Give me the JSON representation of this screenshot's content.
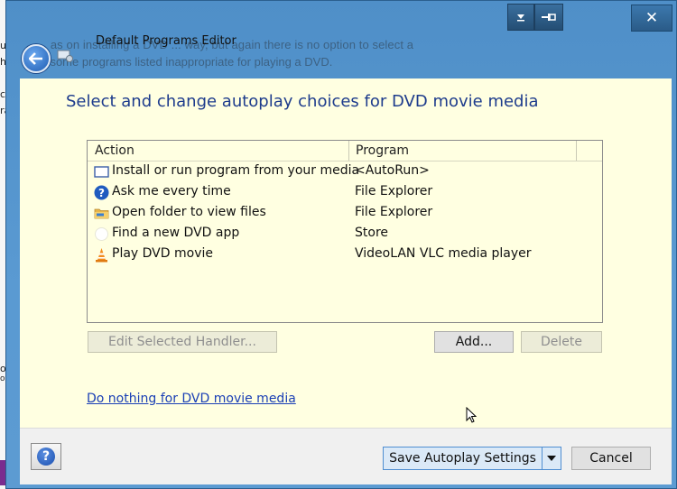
{
  "window": {
    "title": "Default Programs Editor",
    "ghost_line1": "... as on installing a DVD ... way, but again there is no option to select a",
    "ghost_line2": "... some programs listed inappropriate for playing a DVD.",
    "close_label": "✕"
  },
  "background": {
    "frag1": "ult",
    "frag2": "her",
    "frag3": "ck",
    "frag4": "ran",
    "frag5": "ob",
    "frag6": "ow"
  },
  "content": {
    "heading": "Select and change autoplay choices for DVD movie media",
    "columns": {
      "action": "Action",
      "program": "Program"
    },
    "rows": [
      {
        "action": "Install or run program from your media",
        "program": "<AutoRun>",
        "icon": "window-icon"
      },
      {
        "action": "Ask me every time",
        "program": "File Explorer",
        "icon": "question-icon"
      },
      {
        "action": "Open folder to view files",
        "program": "File Explorer",
        "icon": "folder-icon"
      },
      {
        "action": "Find a new DVD app",
        "program": "Store",
        "icon": "blank-icon"
      },
      {
        "action": "Play DVD movie",
        "program": "VideoLAN VLC media player",
        "icon": "vlc-cone-icon"
      }
    ],
    "buttons": {
      "edit": "Edit Selected Handler...",
      "add": "Add...",
      "delete": "Delete"
    },
    "link": "Do nothing for DVD movie media"
  },
  "footer": {
    "help_label": "?",
    "save_label": "Save Autoplay Settings",
    "cancel_label": "Cancel"
  },
  "colors": {
    "content_bg": "#ffffe1",
    "heading": "#1e3c8c",
    "link": "#1a3fb5",
    "frame": "#5a9ad2"
  }
}
